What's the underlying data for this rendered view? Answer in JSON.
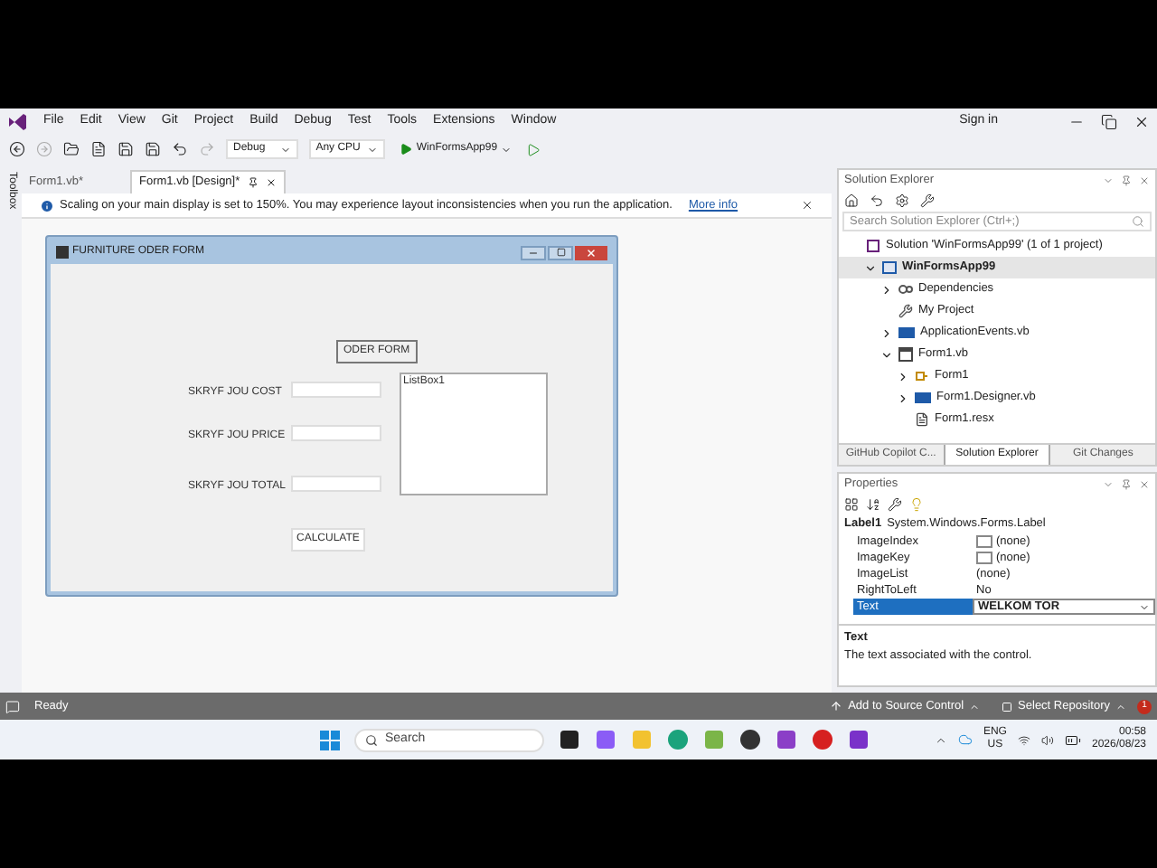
{
  "menu": [
    "File",
    "Edit",
    "View",
    "Git",
    "Project",
    "Build",
    "Debug",
    "Test",
    "Tools",
    "Extensions",
    "Window"
  ],
  "toolbar": {
    "configuration": "Debug",
    "platform": "Any CPU",
    "start_target": "WinFormsApp99"
  },
  "account": "Sign in",
  "side_tab": "Toolbox",
  "doc_tabs": [
    {
      "label": "Form1.vb*",
      "selected": false
    },
    {
      "label": "Form1.vb [Design]*",
      "selected": true
    }
  ],
  "info_bar": {
    "message": "Scaling on your main display is set to 150%. You may experience layout inconsistencies when you run the application.",
    "link": "More info"
  },
  "form": {
    "title": "FURNITURE ODER FORM",
    "header_label": "ODER FORM",
    "listbox": "ListBox1",
    "button": "CALCULATE",
    "rows": [
      {
        "label": "SKRYF JOU COST"
      },
      {
        "label": "SKRYF JOU PRICE"
      },
      {
        "label": "SKRYF JOU TOTAL"
      }
    ]
  },
  "solution_explorer": {
    "title": "Solution Explorer",
    "search_placeholder": "Search Solution Explorer (Ctrl+;)",
    "tree": [
      {
        "label": "Solution 'WinFormsApp99' (1 of 1 project)",
        "kind": "solution",
        "selected": false,
        "children": [
          {
            "label": "WinFormsApp99",
            "kind": "project",
            "selected": true,
            "expanded": true,
            "children": [
              {
                "label": "Dependencies",
                "kind": "dependencies",
                "selected": false,
                "expanded": false
              },
              {
                "label": "My Project",
                "kind": "wrench",
                "selected": false
              },
              {
                "label": "ApplicationEvents.vb",
                "kind": "vb",
                "selected": false,
                "expanded": false
              },
              {
                "label": "Form1.vb",
                "kind": "form",
                "selected": false,
                "expanded": true,
                "children": [
                  {
                    "label": "Form1",
                    "kind": "class",
                    "selected": false,
                    "expanded": false
                  },
                  {
                    "label": "Form1.Designer.vb",
                    "kind": "vb",
                    "selected": false,
                    "expanded": false
                  },
                  {
                    "label": "Form1.resx",
                    "kind": "resx",
                    "selected": false
                  }
                ]
              }
            ]
          }
        ]
      }
    ]
  },
  "bottom_tabs": [
    {
      "label": "GitHub Copilot C...",
      "selected": false
    },
    {
      "label": "Solution Explorer",
      "selected": true
    },
    {
      "label": "Git Changes",
      "selected": false
    }
  ],
  "properties": {
    "title": "Properties",
    "object": "Label1",
    "type": "System.Windows.Forms.Label",
    "rows": [
      {
        "name": "ImageIndex",
        "value": "(none)",
        "kind": "swatch",
        "selected": false
      },
      {
        "name": "ImageKey",
        "value": "(none)",
        "kind": "swatch",
        "selected": false
      },
      {
        "name": "ImageList",
        "value": "(none)",
        "kind": "plain",
        "selected": false
      },
      {
        "name": "RightToLeft",
        "value": "No",
        "kind": "plain",
        "selected": false
      },
      {
        "name": "Text",
        "value": "WELKOM TOR",
        "kind": "plain",
        "selected": true
      }
    ],
    "description_title": "Text",
    "description": "The text associated with the control."
  },
  "status_bar": {
    "text": "Ready",
    "source_control": "Add to Source Control",
    "repository": "Select Repository",
    "notifications": "1"
  },
  "taskbar": {
    "search_placeholder": "Search",
    "language": "ENG",
    "region": "US",
    "time": "00:58",
    "date": "2026/08/23"
  }
}
